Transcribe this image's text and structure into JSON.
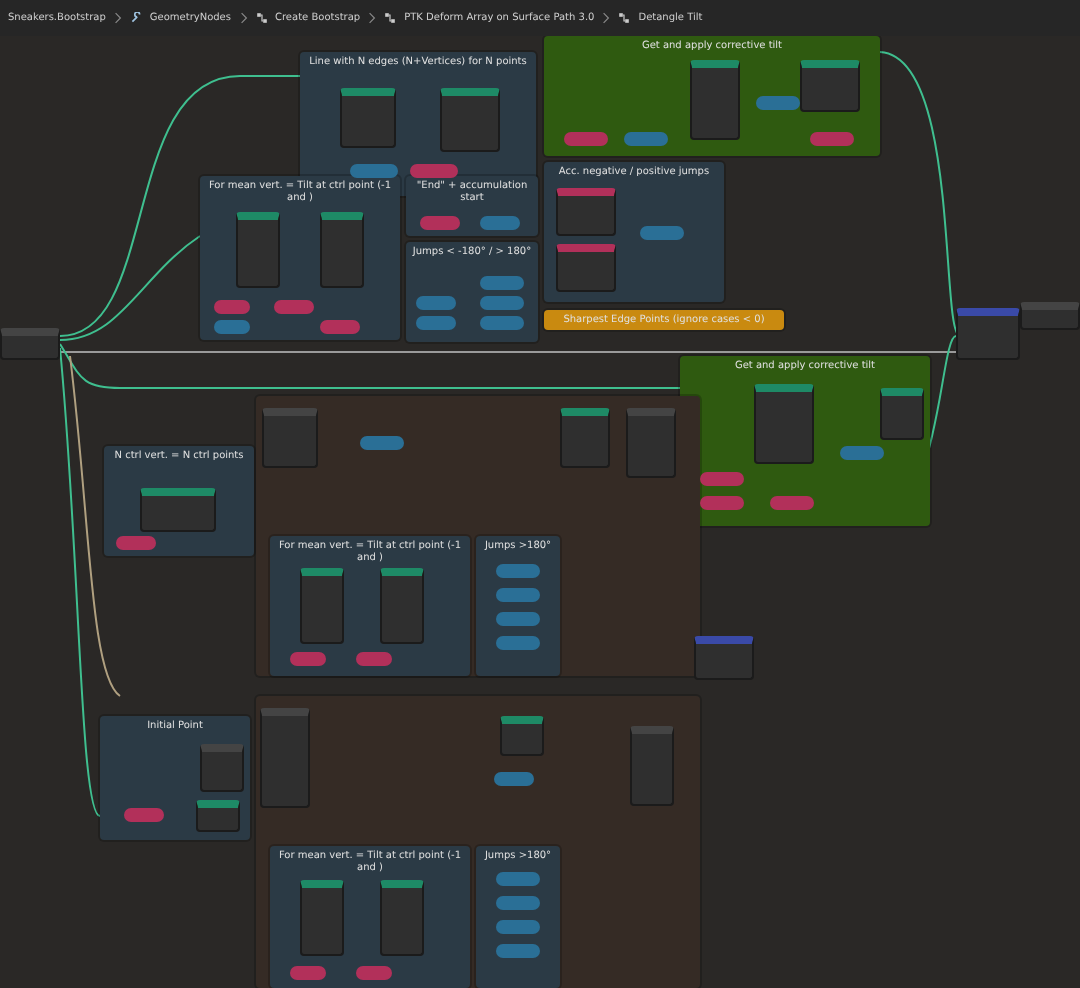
{
  "breadcrumbs": [
    {
      "label": "Sneakers.Bootstrap"
    },
    {
      "label": "GeometryNodes"
    },
    {
      "label": "Create Bootstrap"
    },
    {
      "label": "PTK Deform Array on Surface Path 3.0"
    },
    {
      "label": "Detangle Tilt"
    }
  ],
  "frames": [
    {
      "label": "Line with N edges (N+Vertices) for N points",
      "color": "#2b3a45"
    },
    {
      "label": "For mean vert. = Tilt at ctrl point (-1 and )",
      "color": "#2b3a45"
    },
    {
      "label": "\"End\" + accumulation start",
      "color": "#2b3a45"
    },
    {
      "label": "Jumps < -180° / > 180°",
      "color": "#2b3a45"
    },
    {
      "label": "Acc. negative / positive jumps",
      "color": "#2b3a45"
    },
    {
      "label": "Get and apply corrective tilt",
      "color": "#2f5a10"
    },
    {
      "label": "Sharpest Edge Points (ignore cases < 0)",
      "color": "#c98a10"
    },
    {
      "label": "Get and apply corrective tilt",
      "color": "#2f5a10"
    },
    {
      "color": "#352b25"
    },
    {
      "label": "N ctrl vert. = N ctrl points",
      "color": "#2b3a45"
    },
    {
      "label": "For mean vert. = Tilt at ctrl point (-1 and )",
      "color": "#2b3a45"
    },
    {
      "label": "Jumps >180°",
      "color": "#2b3a45"
    },
    {
      "color": "#352b25"
    },
    {
      "label": "Initial Point",
      "color": "#2b3a45"
    },
    {
      "label": "For mean vert. = Tilt at ctrl point (-1 and )",
      "color": "#2b3a45"
    },
    {
      "label": "Jumps >180°",
      "color": "#2b3a45"
    }
  ],
  "nodes": [
    {
      "kind": "plain"
    },
    {
      "kind": "vector"
    },
    {
      "kind": "plain"
    },
    {
      "kind": "geometry"
    },
    {
      "kind": "geometry"
    },
    {
      "kind": "math"
    },
    {
      "kind": "input"
    },
    {
      "kind": "geometry"
    },
    {
      "kind": "geometry"
    },
    {
      "kind": "input"
    },
    {
      "kind": "input"
    },
    {
      "kind": "math"
    },
    {
      "kind": "input"
    },
    {
      "kind": "input"
    },
    {
      "kind": "math"
    },
    {
      "kind": "math"
    },
    {
      "kind": "math"
    },
    {
      "kind": "math"
    },
    {
      "kind": "math"
    },
    {
      "kind": "math"
    },
    {
      "kind": "input"
    },
    {
      "kind": "input"
    },
    {
      "kind": "math"
    },
    {
      "kind": "geometry"
    },
    {
      "kind": "math"
    },
    {
      "kind": "geometry"
    },
    {
      "kind": "input"
    },
    {
      "kind": "math"
    },
    {
      "kind": "input"
    },
    {
      "kind": "plain"
    },
    {
      "kind": "geometry"
    },
    {
      "kind": "input"
    },
    {
      "kind": "math"
    },
    {
      "kind": "geometry"
    },
    {
      "kind": "geometry"
    },
    {
      "kind": "input"
    },
    {
      "kind": "input"
    },
    {
      "kind": "math"
    },
    {
      "kind": "math"
    },
    {
      "kind": "math"
    },
    {
      "kind": "math"
    },
    {
      "kind": "geometry"
    },
    {
      "kind": "plain"
    },
    {
      "kind": "geometry"
    },
    {
      "kind": "input"
    },
    {
      "kind": "input"
    },
    {
      "kind": "input"
    },
    {
      "kind": "math"
    },
    {
      "kind": "geometry"
    },
    {
      "kind": "vector"
    },
    {
      "kind": "plain"
    },
    {
      "kind": "plain"
    },
    {
      "kind": "geometry"
    },
    {
      "kind": "input"
    },
    {
      "kind": "geometry"
    },
    {
      "kind": "math"
    },
    {
      "kind": "plain"
    },
    {
      "kind": "geometry"
    },
    {
      "kind": "geometry"
    },
    {
      "kind": "input"
    },
    {
      "kind": "input"
    },
    {
      "kind": "math"
    },
    {
      "kind": "math"
    },
    {
      "kind": "math"
    },
    {
      "kind": "math"
    }
  ]
}
